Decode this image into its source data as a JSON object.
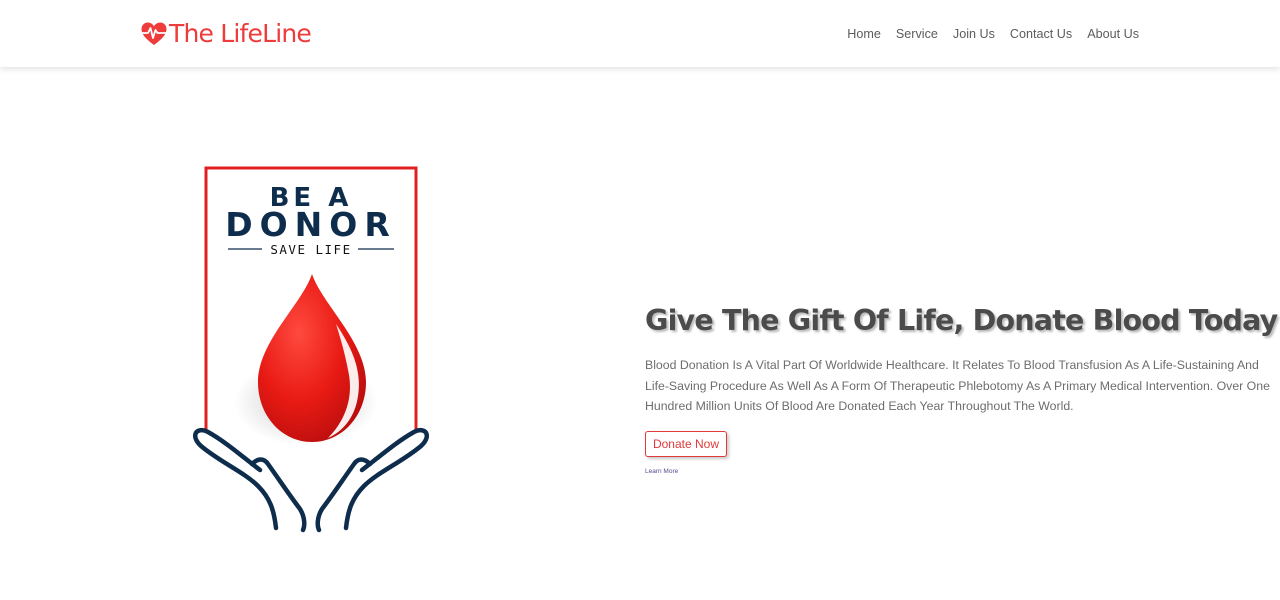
{
  "brand": {
    "name": "The LifeLine",
    "color": "#ee3b3b",
    "icon": "heart-pulse-icon"
  },
  "nav": {
    "items": [
      "Home",
      "Service",
      "Join Us",
      "Contact Us",
      "About Us"
    ]
  },
  "hero": {
    "poster": {
      "line1": "BE A",
      "line2": "DONOR",
      "line3": "SAVE LIFE",
      "icons": [
        "blood-drop-icon",
        "hands-icon"
      ],
      "colors": {
        "frame": "#e0201f",
        "text": "#0e2c4c",
        "drop": "#e01515"
      }
    },
    "title": "Give The Gift Of Life, Donate Blood Today",
    "description": "Blood Donation Is A Vital Part Of Worldwide Healthcare. It Relates To Blood Transfusion As A Life-Sustaining And Life-Saving Procedure As Well As A Form Of Therapeutic Phlebotomy As A Primary Medical Intervention. Over One Hundred Million Units Of Blood Are Donated Each Year Throughout The World.",
    "donate_label": "Donate Now",
    "learn_more_label": "Learn More"
  }
}
